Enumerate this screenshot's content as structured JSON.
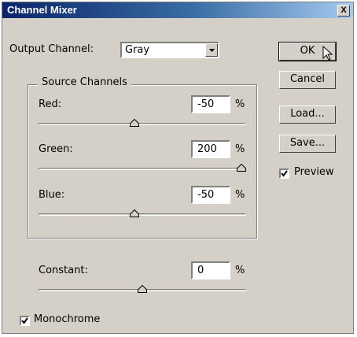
{
  "window": {
    "title": "Channel Mixer",
    "close_label": "X"
  },
  "output": {
    "label": "Output Channel:",
    "value": "Gray"
  },
  "source_group": {
    "legend": "Source Channels"
  },
  "channels": [
    {
      "label": "Red:",
      "value": "-50",
      "unit": "%",
      "slider_fraction": 0.46
    },
    {
      "label": "Green:",
      "value": "200",
      "unit": "%",
      "slider_fraction": 1.0
    },
    {
      "label": "Blue:",
      "value": "-50",
      "unit": "%",
      "slider_fraction": 0.46
    }
  ],
  "constant": {
    "label": "Constant:",
    "value": "0",
    "unit": "%",
    "slider_fraction": 0.5
  },
  "buttons": {
    "ok": "OK",
    "cancel": "Cancel",
    "load": "Load...",
    "save": "Save..."
  },
  "preview": {
    "label": "Preview",
    "checked": true
  },
  "monochrome": {
    "label": "Monochrome",
    "checked": true
  }
}
